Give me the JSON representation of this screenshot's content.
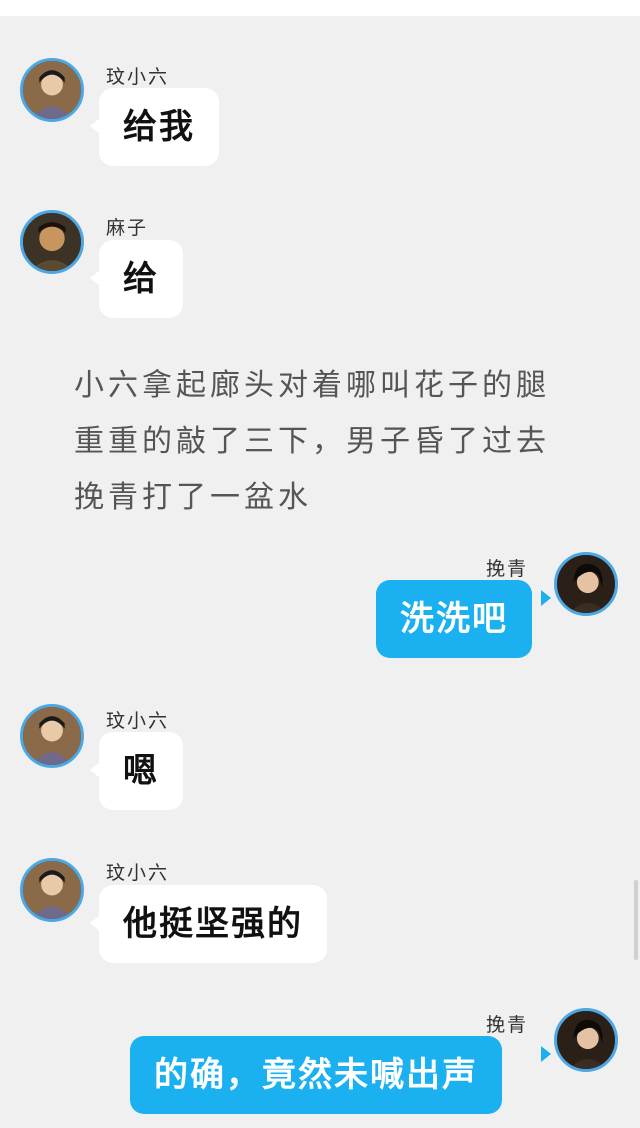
{
  "colors": {
    "background": "#f0f0f0",
    "left_bubble": "#ffffff",
    "right_bubble": "#1bb0f0",
    "avatar_ring": "#4aa8e6"
  },
  "messages": [
    {
      "sender": "玟小六",
      "text": "给我",
      "side": "left"
    },
    {
      "sender": "麻子",
      "text": "给",
      "side": "left"
    },
    {
      "sender": "挽青",
      "text": "洗洗吧",
      "side": "right"
    },
    {
      "sender": "玟小六",
      "text": "嗯",
      "side": "left"
    },
    {
      "sender": "玟小六",
      "text": "他挺坚强的",
      "side": "left"
    },
    {
      "sender": "挽青",
      "text": "的确，竟然未喊出声",
      "side": "right"
    }
  ],
  "narration": "小六拿起廊头对着哪叫花子的腿重重的敲了三下，男子昏了过去挽青打了一盆水"
}
